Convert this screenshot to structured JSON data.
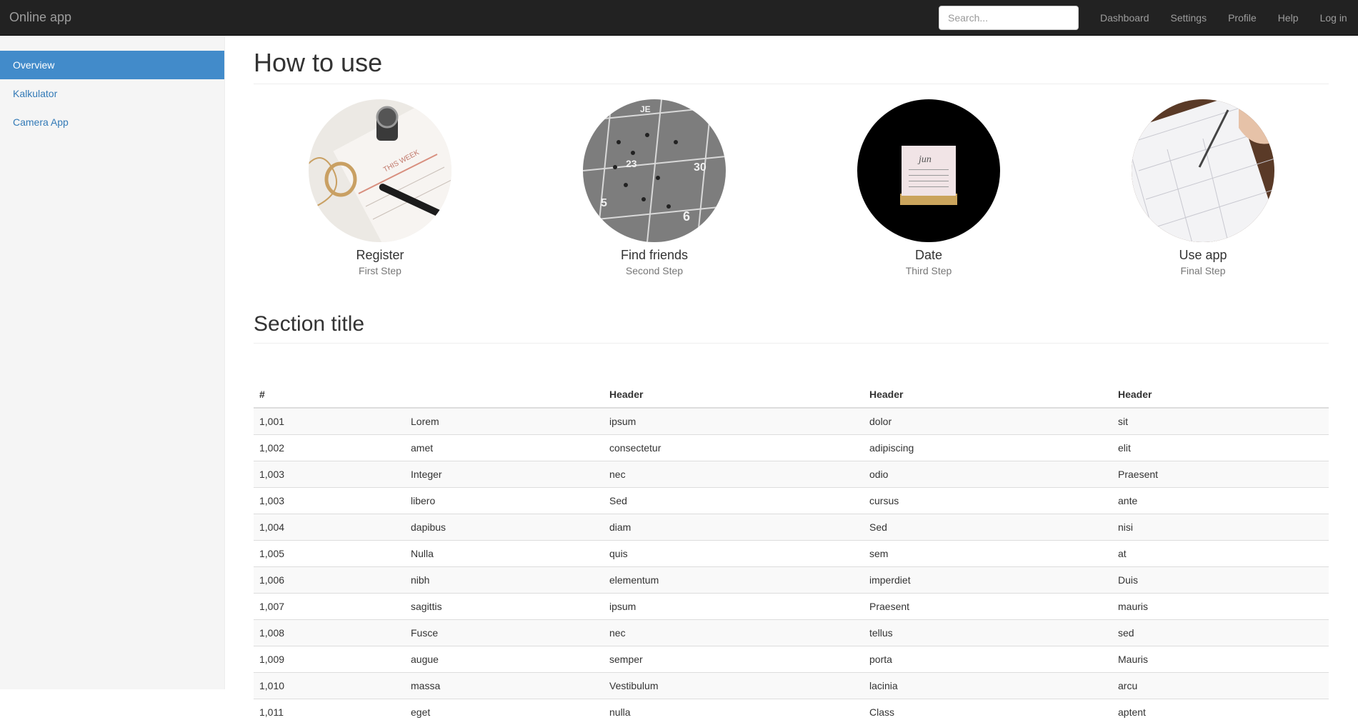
{
  "app": {
    "brand": "Online app"
  },
  "search": {
    "placeholder": "Search..."
  },
  "topnav": [
    "Dashboard",
    "Settings",
    "Profile",
    "Help",
    "Log in"
  ],
  "sidebar": {
    "items": [
      {
        "label": "Overview",
        "active": true
      },
      {
        "label": "Kalkulator",
        "active": false
      },
      {
        "label": "Camera App",
        "active": false
      }
    ]
  },
  "main": {
    "title": "How to use",
    "steps": [
      {
        "title": "Register",
        "subtitle": "First Step"
      },
      {
        "title": "Find friends",
        "subtitle": "Second Step"
      },
      {
        "title": "Date",
        "subtitle": "Third Step"
      },
      {
        "title": "Use app",
        "subtitle": "Final Step"
      }
    ],
    "section_title": "Section title",
    "table": {
      "headers": [
        "#",
        "",
        "Header",
        "Header",
        "Header"
      ],
      "rows": [
        [
          "1,001",
          "Lorem",
          "ipsum",
          "dolor",
          "sit"
        ],
        [
          "1,002",
          "amet",
          "consectetur",
          "adipiscing",
          "elit"
        ],
        [
          "1,003",
          "Integer",
          "nec",
          "odio",
          "Praesent"
        ],
        [
          "1,003",
          "libero",
          "Sed",
          "cursus",
          "ante"
        ],
        [
          "1,004",
          "dapibus",
          "diam",
          "Sed",
          "nisi"
        ],
        [
          "1,005",
          "Nulla",
          "quis",
          "sem",
          "at"
        ],
        [
          "1,006",
          "nibh",
          "elementum",
          "imperdiet",
          "Duis"
        ],
        [
          "1,007",
          "sagittis",
          "ipsum",
          "Praesent",
          "mauris"
        ],
        [
          "1,008",
          "Fusce",
          "nec",
          "tellus",
          "sed"
        ],
        [
          "1,009",
          "augue",
          "semper",
          "porta",
          "Mauris"
        ],
        [
          "1,010",
          "massa",
          "Vestibulum",
          "lacinia",
          "arcu"
        ],
        [
          "1,011",
          "eget",
          "nulla",
          "Class",
          "aptent"
        ]
      ]
    }
  },
  "colors": {
    "navbar": "#222222",
    "active": "#428bca",
    "link": "#337ab7"
  }
}
